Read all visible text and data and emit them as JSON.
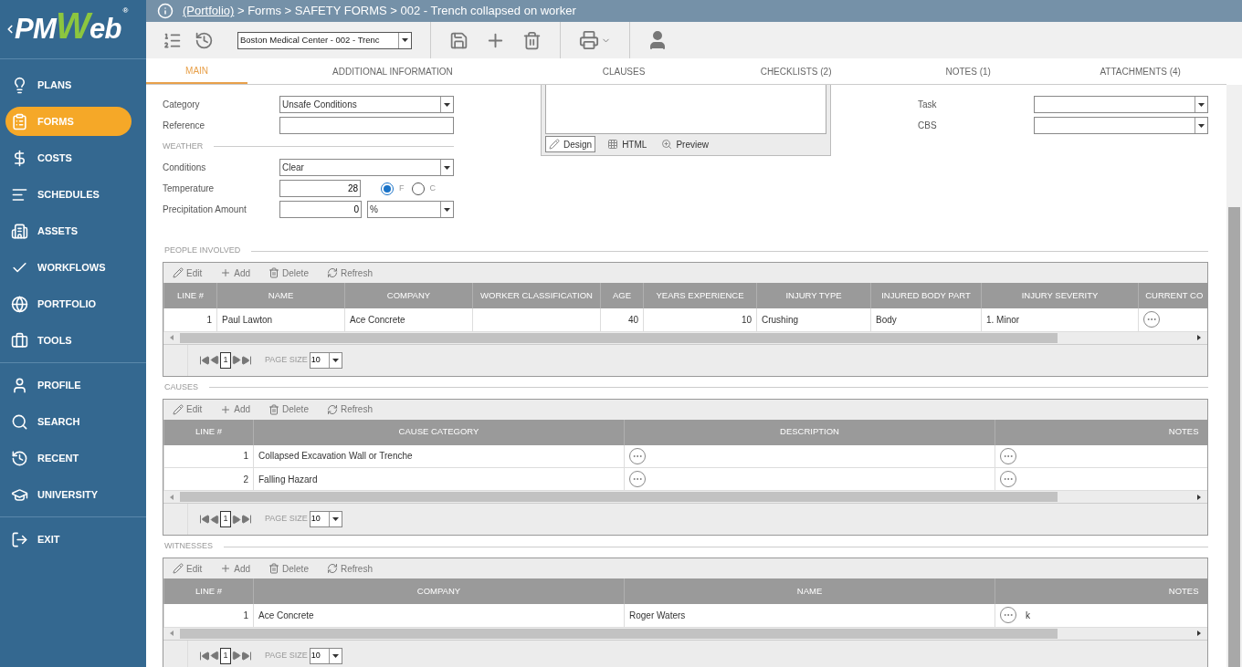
{
  "logo": {
    "left": "PM",
    "mark": "W",
    "right": "eb",
    "reg": "®"
  },
  "sidebar": {
    "groups": [
      [
        {
          "label": "PLANS",
          "selected": false
        },
        {
          "label": "FORMS",
          "selected": true
        },
        {
          "label": "COSTS",
          "selected": false
        },
        {
          "label": "SCHEDULES",
          "selected": false
        },
        {
          "label": "ASSETS",
          "selected": false
        },
        {
          "label": "WORKFLOWS",
          "selected": false
        },
        {
          "label": "PORTFOLIO",
          "selected": false
        },
        {
          "label": "TOOLS",
          "selected": false
        }
      ],
      [
        {
          "label": "PROFILE",
          "selected": false
        },
        {
          "label": "SEARCH",
          "selected": false
        },
        {
          "label": "RECENT",
          "selected": false
        },
        {
          "label": "UNIVERSITY",
          "selected": false
        }
      ],
      [
        {
          "label": "EXIT",
          "selected": false
        }
      ]
    ]
  },
  "breadcrumb": {
    "link": "(Portfolio)",
    "rest": " > Forms > SAFETY FORMS > 002 - Trench collapsed on worker"
  },
  "toolbar": {
    "record": "Boston Medical Center - 002 - Trenc"
  },
  "tabs": [
    {
      "label": "MAIN",
      "selected": true
    },
    {
      "label": "ADDITIONAL INFORMATION",
      "selected": false
    },
    {
      "label": "CLAUSES",
      "selected": false
    },
    {
      "label": "CHECKLISTS (2)",
      "selected": false
    },
    {
      "label": "NOTES (1)",
      "selected": false
    },
    {
      "label": "ATTACHMENTS (4)",
      "selected": false
    }
  ],
  "form": {
    "fields": [
      {
        "kind": "select",
        "label": "Category",
        "value": "Unsafe Conditions"
      },
      {
        "kind": "text",
        "label": "Reference"
      },
      {
        "kind": "section",
        "label": "WEATHER"
      },
      {
        "kind": "select",
        "label": "Conditions",
        "value": "Clear"
      },
      {
        "kind": "temperature",
        "label": "Temperature",
        "value": "28",
        "units": [
          {
            "label": "F",
            "selected": true
          },
          {
            "label": "C",
            "selected": false
          }
        ]
      },
      {
        "kind": "amount",
        "label": "Precipitation Amount",
        "value": "0",
        "unit": "%"
      }
    ],
    "editor": {
      "buttons": [
        {
          "label": "Design",
          "selected": true
        },
        {
          "label": "HTML",
          "selected": false
        },
        {
          "label": "Preview",
          "selected": false
        }
      ]
    },
    "right_fields": [
      {
        "kind": "select",
        "label": "Task"
      },
      {
        "kind": "select",
        "label": "CBS"
      }
    ]
  },
  "grids": [
    {
      "title": "PEOPLE INVOLVED",
      "actions": [
        "Edit",
        "Add",
        "Delete",
        "Refresh"
      ],
      "columns": [
        {
          "label": "LINE #",
          "kind": "number"
        },
        {
          "label": "NAME",
          "kind": "text"
        },
        {
          "label": "COMPANY",
          "kind": "text"
        },
        {
          "label": "WORKER CLASSIFICATION",
          "kind": "text"
        },
        {
          "label": "AGE",
          "kind": "number"
        },
        {
          "label": "YEARS EXPERIENCE",
          "kind": "number"
        },
        {
          "label": "INJURY TYPE",
          "kind": "text"
        },
        {
          "label": "INJURED BODY PART",
          "kind": "text"
        },
        {
          "label": "INJURY SEVERITY",
          "kind": "text"
        },
        {
          "label": "CURRENT CO",
          "kind": "memo"
        }
      ],
      "rows": [
        [
          "1",
          "Paul Lawton",
          "Ace Concrete",
          "",
          "40",
          "10",
          "Crushing",
          "Body",
          "1. Minor",
          ""
        ]
      ],
      "pager": {
        "page": "1",
        "size_label": "PAGE SIZE",
        "size": "10"
      }
    },
    {
      "title": "CAUSES",
      "actions": [
        "Edit",
        "Add",
        "Delete",
        "Refresh"
      ],
      "columns": [
        {
          "label": "LINE #",
          "kind": "number"
        },
        {
          "label": "CAUSE CATEGORY",
          "kind": "text"
        },
        {
          "label": "DESCRIPTION",
          "kind": "memo"
        },
        {
          "label": "NOTES",
          "kind": "memo"
        }
      ],
      "rows": [
        [
          "1",
          "Collapsed Excavation Wall or Trenche",
          "",
          ""
        ],
        [
          "2",
          "Falling Hazard",
          "",
          ""
        ]
      ],
      "pager": {
        "page": "1",
        "size_label": "PAGE SIZE",
        "size": "10"
      }
    },
    {
      "title": "WITNESSES",
      "actions": [
        "Edit",
        "Add",
        "Delete",
        "Refresh"
      ],
      "columns": [
        {
          "label": "LINE #",
          "kind": "number"
        },
        {
          "label": "COMPANY",
          "kind": "text"
        },
        {
          "label": "NAME",
          "kind": "text"
        },
        {
          "label": "NOTES",
          "kind": "memo"
        }
      ],
      "rows": [
        [
          "1",
          "Ace Concrete",
          "Roger Waters",
          "k"
        ]
      ],
      "pager": {
        "page": "1",
        "size_label": "PAGE SIZE",
        "size": "10"
      }
    }
  ]
}
